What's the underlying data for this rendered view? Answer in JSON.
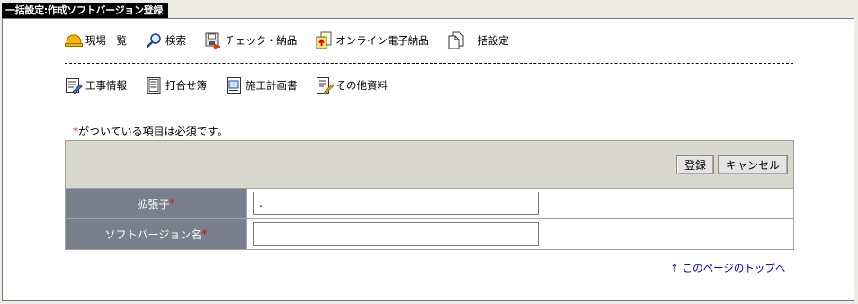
{
  "page": {
    "title": "一括設定:作成ソフトバージョン登録"
  },
  "nav_primary": [
    {
      "label": "現場一覧",
      "icon": "helmet-icon"
    },
    {
      "label": "検索",
      "icon": "search-icon"
    },
    {
      "label": "チェック・納品",
      "icon": "check-delivery-icon"
    },
    {
      "label": "オンライン電子納品",
      "icon": "online-delivery-icon"
    },
    {
      "label": "一括設定",
      "icon": "batch-settings-icon"
    }
  ],
  "nav_secondary": [
    {
      "label": "工事情報",
      "icon": "construction-info-icon"
    },
    {
      "label": "打合せ簿",
      "icon": "meeting-log-icon"
    },
    {
      "label": "施工計画書",
      "icon": "construction-plan-icon"
    },
    {
      "label": "その他資料",
      "icon": "other-docs-icon"
    }
  ],
  "required_note": {
    "star": "*",
    "text": "がついている項目は必須です。"
  },
  "buttons": {
    "register": "登録",
    "cancel": "キャンセル"
  },
  "form": {
    "extension": {
      "label": "拡張子",
      "star": "*",
      "value": "."
    },
    "software_version": {
      "label": "ソフトバージョン名",
      "star": "*",
      "value": ""
    }
  },
  "footer": {
    "top_link_arrow": "↑",
    "top_link": "このページのトップへ"
  },
  "colors": {
    "label_bg": "#797f8c",
    "toolbar_bg": "#d8d9cc",
    "required": "#d40000",
    "link": "#0000cc"
  }
}
